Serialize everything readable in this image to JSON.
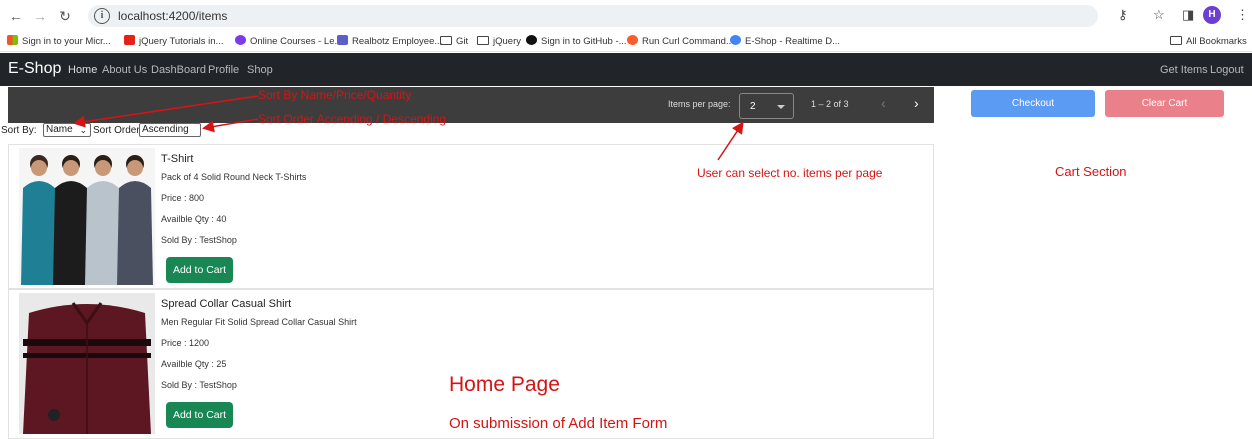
{
  "browser": {
    "url": "localhost:4200/items",
    "bookmarks": [
      {
        "label": "Sign in to your Micr...",
        "color": "#f35325"
      },
      {
        "label": "jQuery Tutorials in...",
        "color": "#e62117"
      },
      {
        "label": "Online Courses - Le...",
        "color": "#7c3aed"
      },
      {
        "label": "Realbotz Employee...",
        "color": "#5b5fc7"
      },
      {
        "label": "Git",
        "color": ""
      },
      {
        "label": "jQuery",
        "color": ""
      },
      {
        "label": "Sign in to GitHub -...",
        "color": "#111111"
      },
      {
        "label": "Run Curl Command...",
        "color": "#ff5a2d"
      },
      {
        "label": "E-Shop - Realtime D...",
        "color": "#4285f4"
      }
    ],
    "all_bookmarks": "All Bookmarks",
    "avatar_letter": "H"
  },
  "navbar": {
    "brand": "E-Shop",
    "links": [
      "Home",
      "About Us",
      "DashBoard",
      "Profile",
      "Shop"
    ],
    "right_links": [
      "Get Items",
      "Logout"
    ]
  },
  "paginator": {
    "items_per_page_label": "Items per page:",
    "items_per_page_value": "2",
    "range_label": "1 – 2 of 3"
  },
  "sort": {
    "sort_by_label": "Sort By:",
    "sort_by_value": "Name",
    "sort_order_label": "Sort Order:",
    "sort_order_value": "Ascending"
  },
  "products": [
    {
      "name": "T-Shirt",
      "description": "Pack of 4 Solid Round Neck T-Shirts",
      "price": "Price : 800",
      "qty": "Availble Qty : 40",
      "seller": "Sold By : TestShop",
      "button": "Add to Cart"
    },
    {
      "name": "Spread Collar Casual Shirt",
      "description": "Men Regular Fit Solid Spread Collar Casual Shirt",
      "price": "Price : 1200",
      "qty": "Availble Qty : 25",
      "seller": "Sold By : TestShop",
      "button": "Add to Cart"
    }
  ],
  "cart": {
    "checkout": "Checkout",
    "clear": "Clear Cart"
  },
  "annotations": {
    "sort_by_hint": "Sort By Name/Price/Quantity",
    "sort_order_hint": "Sort Order Accending / Descending",
    "per_page_hint": "User can select no. items per page",
    "cart_section": "Cart Section",
    "home_page": "Home Page",
    "submission": "On submission of Add Item Form"
  },
  "colors": {
    "navbar": "#212529",
    "success": "#198754",
    "checkout": "#5b9bf3",
    "clear_cart": "#e9808a",
    "annotation": "#d51414"
  }
}
